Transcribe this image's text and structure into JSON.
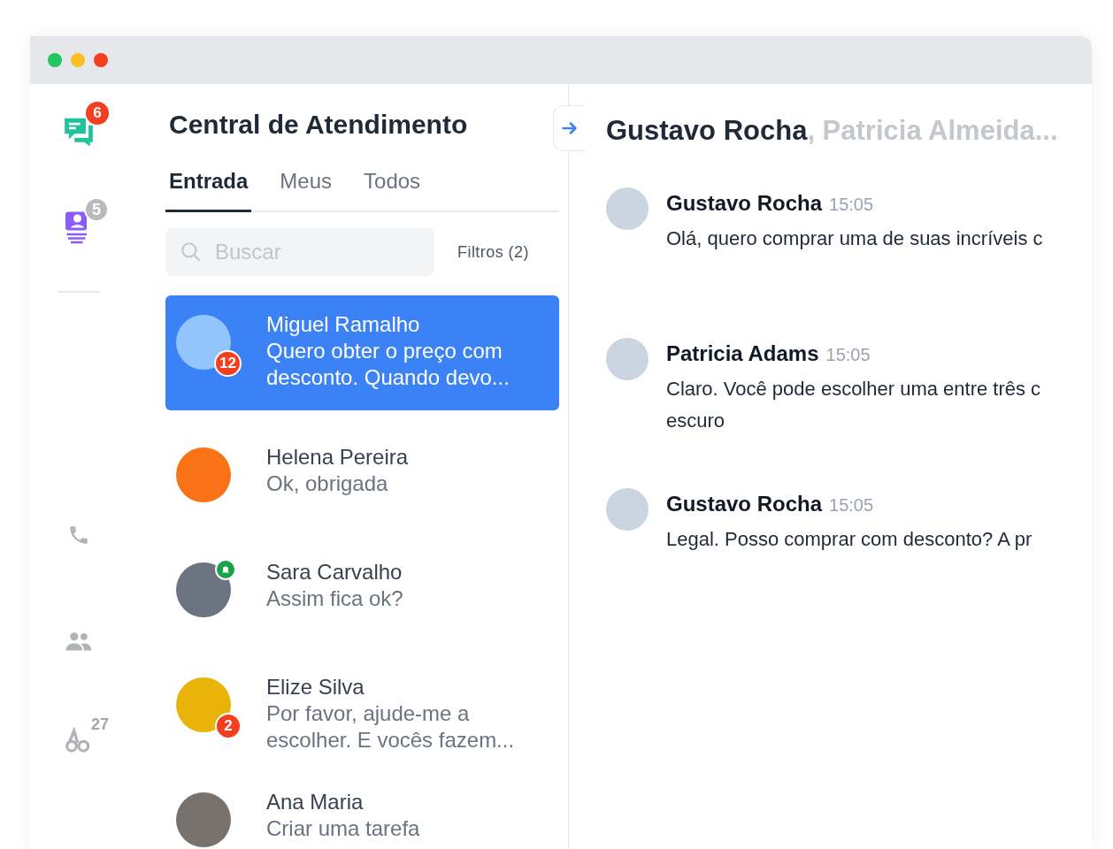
{
  "window": {
    "controls": [
      {
        "color": "#22c55e"
      },
      {
        "color": "#fbbf24"
      },
      {
        "color": "#f43f1e"
      }
    ]
  },
  "sidebar": {
    "items": [
      {
        "kind": "chat",
        "badge": "6"
      },
      {
        "kind": "queue",
        "badge": "5"
      },
      {
        "kind": "divider"
      },
      {
        "kind": "phone"
      },
      {
        "kind": "people"
      },
      {
        "kind": "mentions",
        "badge": "27"
      }
    ]
  },
  "inbox": {
    "title": "Central de Atendimento",
    "tabs": [
      {
        "label": "Entrada",
        "selected": true
      },
      {
        "label": "Meus",
        "selected": false
      },
      {
        "label": "Todos",
        "selected": false
      }
    ],
    "search": {
      "placeholder": "Buscar"
    },
    "filters": "Filtros (2)",
    "conversations": [
      {
        "name": "Miguel Ramalho",
        "preview": "Quero obter o preço com desconto. Quando devo...",
        "selected": true,
        "badge": "12",
        "online": false,
        "color": "#93c5fd"
      },
      {
        "name": "Helena Pereira",
        "preview": "Ok, obrigada",
        "selected": false,
        "online": false,
        "color": "#f97316"
      },
      {
        "name": "Sara Carvalho",
        "preview": "Assim fica ok?",
        "selected": false,
        "online": true,
        "color": "#6b7280"
      },
      {
        "name": "Elize Silva",
        "preview": "Por favor, ajude-me a escolher. E vocês fazem...",
        "selected": false,
        "badge": "2",
        "online": false,
        "color": "#eab308"
      },
      {
        "name": "Ana Maria",
        "preview": "Criar uma tarefa",
        "selected": false,
        "online": false,
        "color": "#78716c"
      }
    ]
  },
  "chat": {
    "header": {
      "name": "Gustavo Rocha",
      "others": ", Patricia Almeida..."
    },
    "messages": [
      {
        "author": "Gustavo Rocha",
        "time": "15:05",
        "text": "Olá, quero comprar uma de suas incríveis c"
      },
      {
        "author": "Patricia Adams",
        "time": "15:05",
        "text": "Claro. Você pode escolher uma entre três c\nescuro"
      },
      {
        "author": "Gustavo Rocha",
        "time": "15:05",
        "text": "Legal. Posso comprar com desconto? A pr"
      }
    ]
  }
}
